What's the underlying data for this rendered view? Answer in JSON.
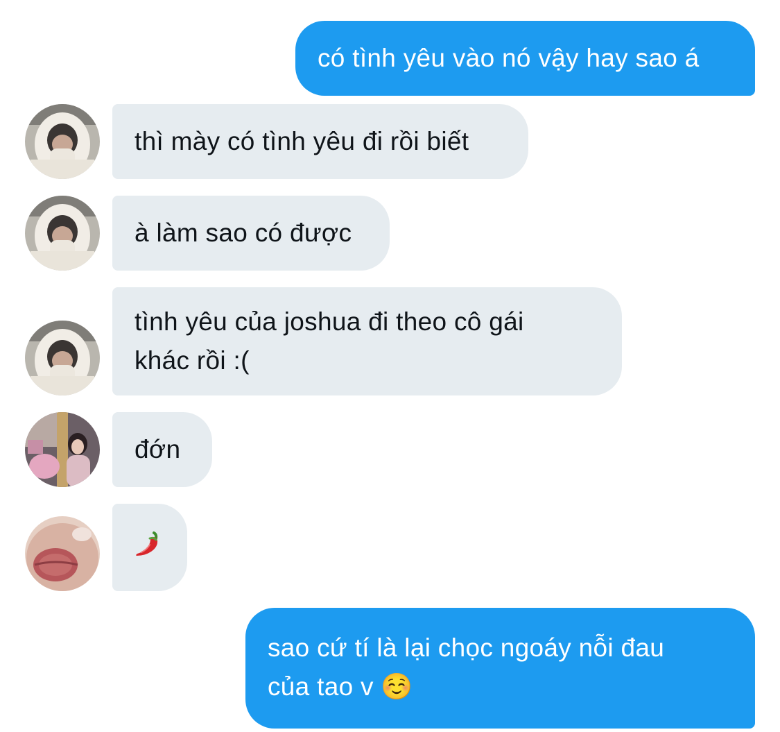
{
  "messages": [
    {
      "text": "có tình yêu vào nó vậy hay sao á"
    },
    {
      "text": "thì mày có tình yêu đi rồi biết"
    },
    {
      "text": "à làm sao có được"
    },
    {
      "line1": "tình yêu của joshua đi theo cô gái",
      "line2": "khác rồi :("
    },
    {
      "text": "đớn"
    },
    {
      "text": "🌶️",
      "icon": "chili-pepper-icon"
    },
    {
      "line1": "sao cứ tí là lại chọc ngoáy nỗi đau",
      "line2": "của tao v ☺️"
    }
  ],
  "colors": {
    "sent_bubble": "#1d9bf0",
    "received_bubble": "#e6ecf0",
    "received_text": "#0f1419",
    "sent_text": "#ffffff"
  }
}
